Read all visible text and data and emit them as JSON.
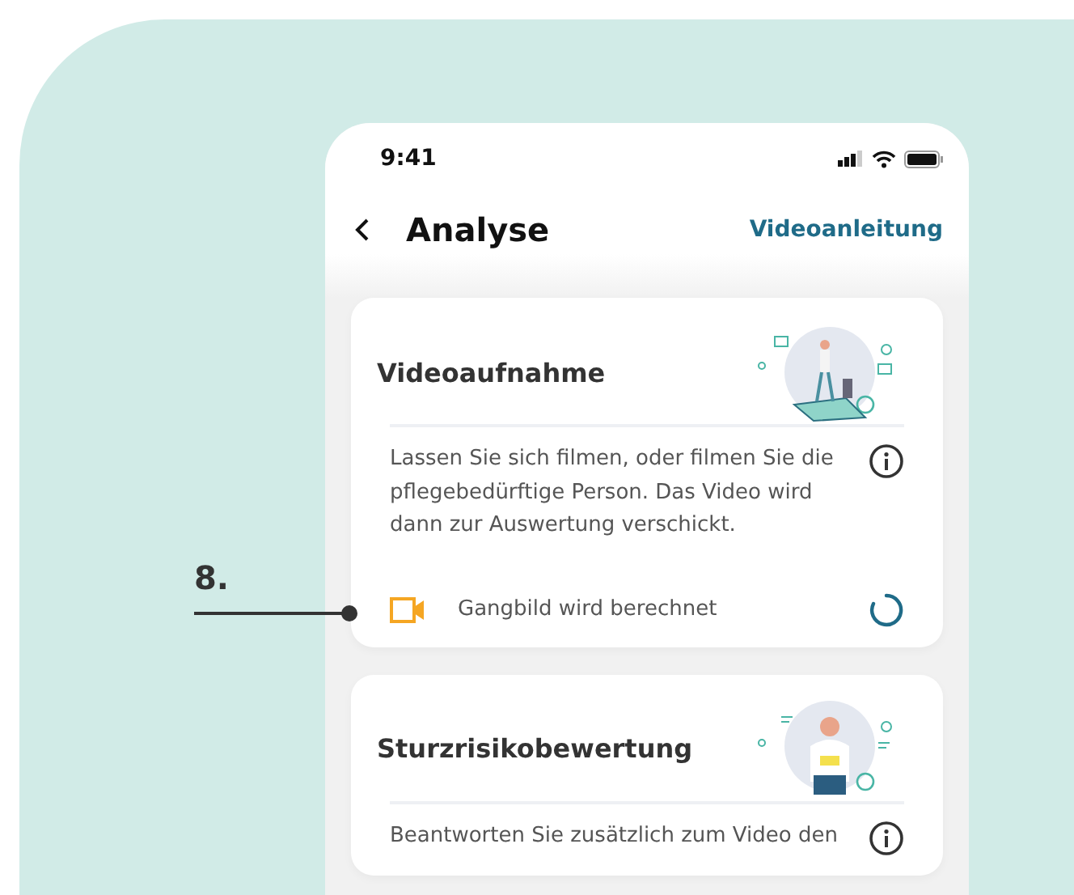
{
  "annotation": {
    "label": "8."
  },
  "status_bar": {
    "time": "9:41"
  },
  "nav": {
    "title": "Analyse",
    "link": "Videoanleitung"
  },
  "cards": [
    {
      "kind": "video",
      "title": "Videoaufnahme",
      "description": "Lassen Sie sich filmen, oder filmen Sie die pflegebedürftige Person. Das Video wird dann zur Auswertung verschickt.",
      "status": {
        "text": "Gangbild wird berechnet",
        "kind": "in_progress"
      }
    },
    {
      "kind": "survey",
      "title": "Sturzrisikobewertung",
      "description": "Beantworten Sie zusätzlich zum Video den"
    }
  ]
}
